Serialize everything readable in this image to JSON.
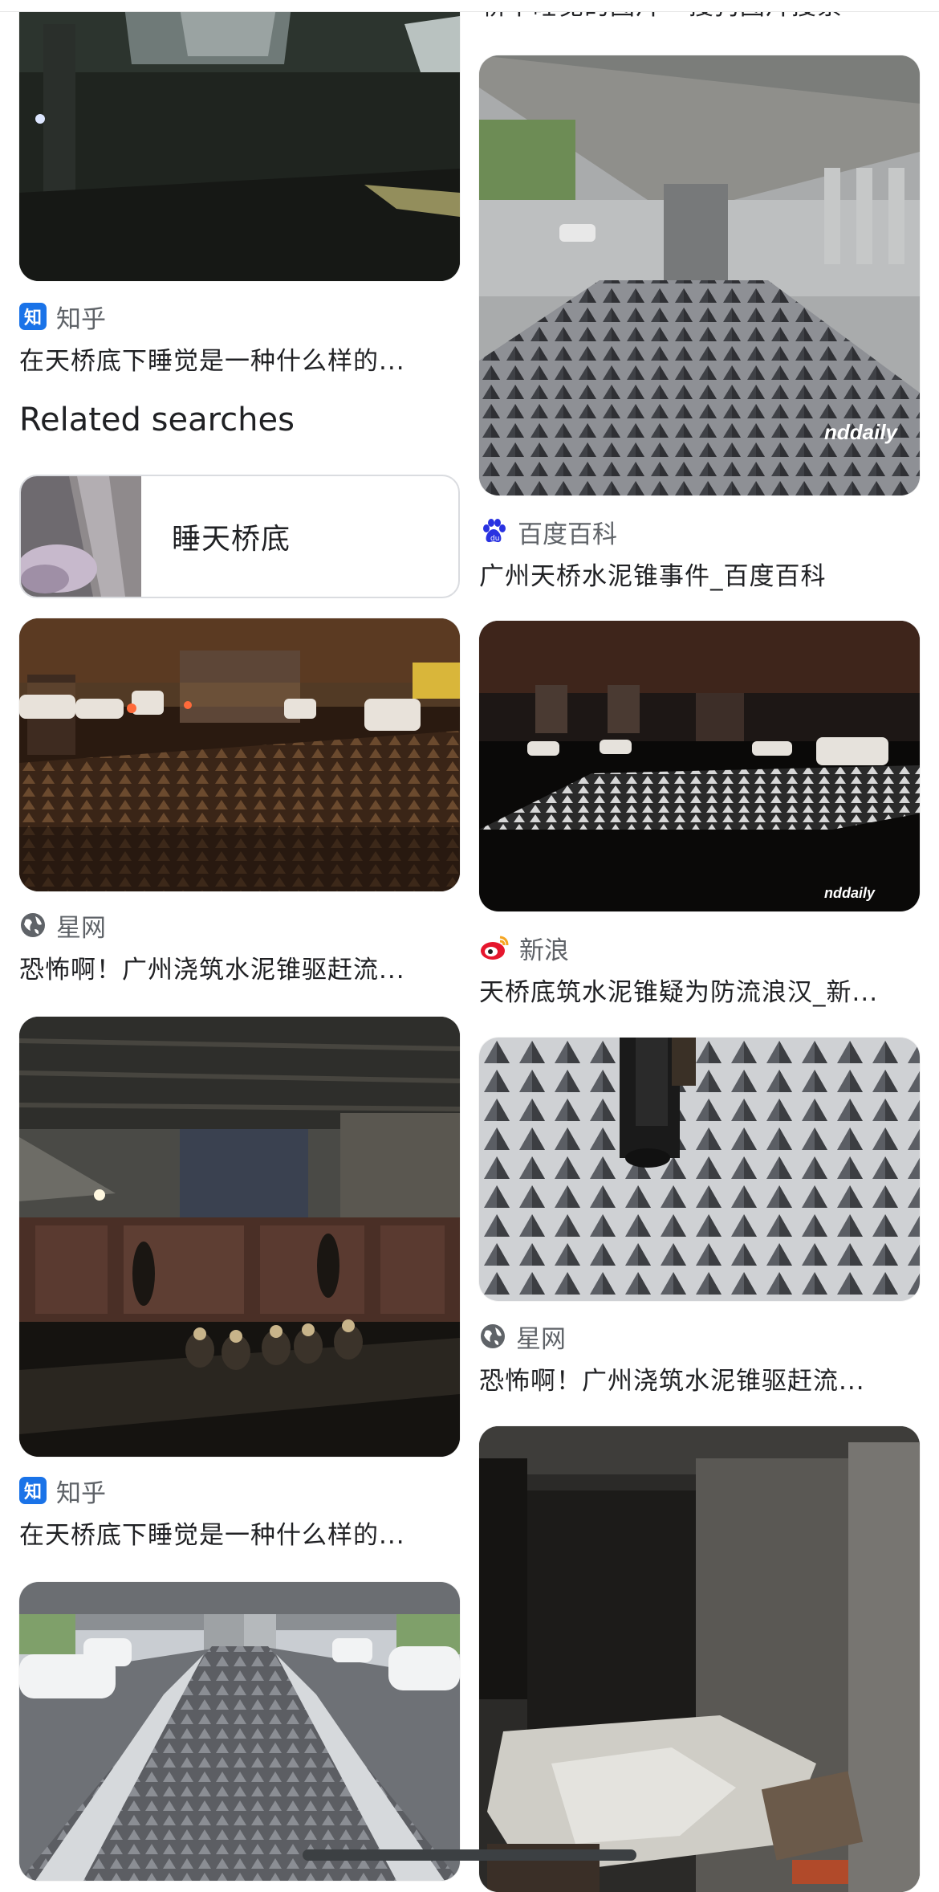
{
  "top_cut_caption": "桥下睡觉的图片 - 搜狗图片搜索",
  "related": {
    "title": "Related searches",
    "chip_label": "睡天桥底"
  },
  "left": [
    {
      "source": "知乎",
      "caption": "在天桥底下睡觉是一种什么样的...",
      "icon": "zhihu-icon"
    },
    {
      "source": "星网",
      "caption": "恐怖啊！广州浇筑水泥锥驱赶流...",
      "icon": "globe-icon"
    },
    {
      "source": "知乎",
      "caption": "在天桥底下睡觉是一种什么样的...",
      "icon": "zhihu-icon"
    }
  ],
  "right": [
    {
      "source": "百度百科",
      "caption": "广州天桥水泥锥事件_百度百科",
      "icon": "baidu-paw-icon",
      "watermark": "nddaily"
    },
    {
      "source": "新浪",
      "caption": "天桥底筑水泥锥疑为防流浪汉_新...",
      "icon": "weibo-icon",
      "watermark": "nddaily"
    },
    {
      "source": "星网",
      "caption": "恐怖啊！广州浇筑水泥锥驱赶流...",
      "icon": "globe-icon"
    }
  ],
  "colors": {
    "accent": "#1a73e8",
    "weibo": "#e6162d",
    "baidu": "#2932e1",
    "text_secondary": "#5f6368"
  }
}
